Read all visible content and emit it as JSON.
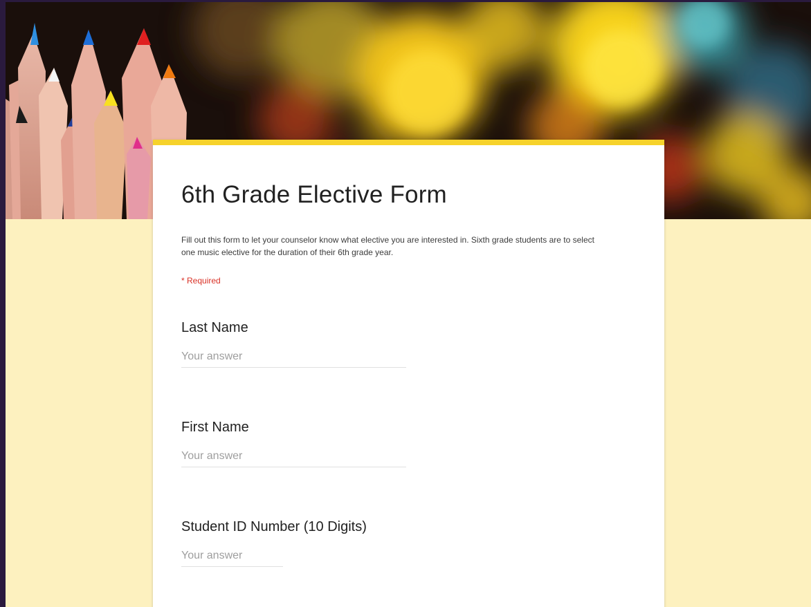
{
  "form": {
    "title": "6th Grade Elective Form",
    "description": "Fill out this form to let your counselor know what elective you are interested in. Sixth grade students are to select one music elective for the duration of their 6th grade year.",
    "required_note": "* Required",
    "accent_color": "#f6d22b",
    "background_color": "#fdf1bf",
    "questions": [
      {
        "label": "Last Name",
        "placeholder": "Your answer"
      },
      {
        "label": "First Name",
        "placeholder": "Your answer"
      },
      {
        "label": "Student ID Number (10 Digits)",
        "placeholder": "Your answer"
      }
    ]
  },
  "banner": {
    "icon": "colored-pencils-bokeh-image"
  }
}
